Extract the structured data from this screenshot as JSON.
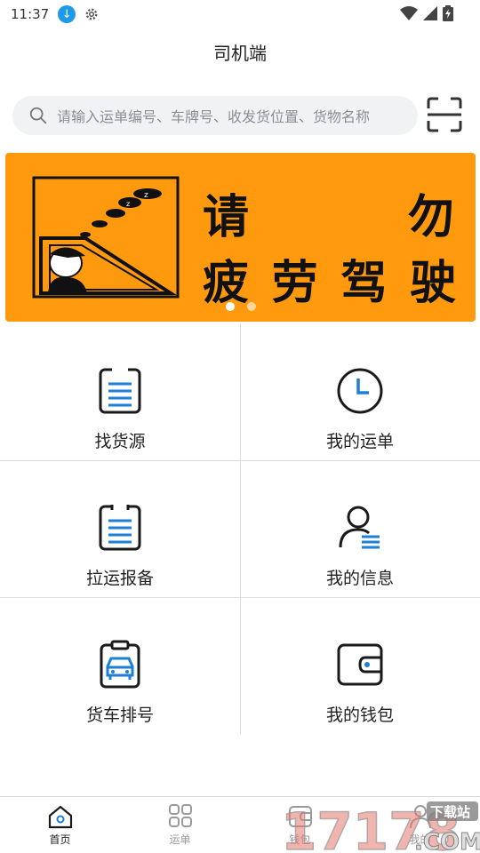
{
  "status_bar": {
    "time": "11:37"
  },
  "header": {
    "title": "司机端"
  },
  "search": {
    "placeholder": "请输入运单编号、车牌号、收发货位置、货物名称"
  },
  "banner": {
    "line1": [
      "请",
      "勿"
    ],
    "line2": [
      "疲",
      "劳",
      "驾",
      "驶"
    ],
    "slide_count": 2,
    "active_slide": 1
  },
  "grid": {
    "items": [
      {
        "label": "找货源",
        "icon": "document-list-icon"
      },
      {
        "label": "我的运单",
        "icon": "clock-icon"
      },
      {
        "label": "拉运报备",
        "icon": "clipboard-list-icon"
      },
      {
        "label": "我的信息",
        "icon": "user-info-icon"
      },
      {
        "label": "货车排号",
        "icon": "truck-queue-icon"
      },
      {
        "label": "我的钱包",
        "icon": "wallet-icon"
      }
    ]
  },
  "bottom_nav": {
    "items": [
      {
        "label": "首页",
        "icon": "home-icon",
        "active": true
      },
      {
        "label": "运单",
        "icon": "grid-icon",
        "active": false
      },
      {
        "label": "钱包",
        "icon": "wallet-icon",
        "active": false
      },
      {
        "label": "我的",
        "icon": "user-icon",
        "active": false
      }
    ]
  },
  "watermark": {
    "text": "17178",
    "site": "下载站",
    "suffix": ".COM"
  },
  "colors": {
    "accent": "#1e7fd6",
    "banner_bg": "#ff9a0e",
    "icon_dark": "#1a1a1a"
  }
}
